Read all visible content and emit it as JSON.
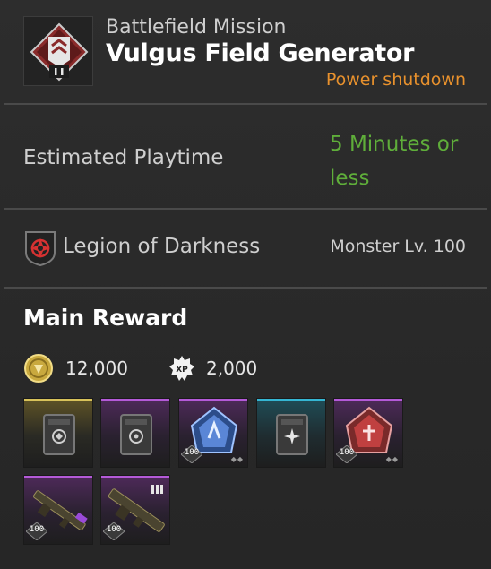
{
  "mission": {
    "category": "Battlefield Mission",
    "title": "Vulgus Field Generator",
    "subtitle": "Power shutdown",
    "icon": "mission-chevron-emblem"
  },
  "playtime": {
    "label": "Estimated Playtime",
    "value": "5 Minutes or less"
  },
  "faction": {
    "name": "Legion of Darkness",
    "monster_level": "Monster Lv. 100",
    "icon": "legion-of-darkness-emblem"
  },
  "rewards": {
    "title": "Main Reward",
    "gold": "12,000",
    "xp": "2,000",
    "xp_badge": "XP",
    "items": [
      {
        "rarity": "gold",
        "icon": "mod-module-icon",
        "level": ""
      },
      {
        "rarity": "purple",
        "icon": "mod-module-icon",
        "level": ""
      },
      {
        "rarity": "purple",
        "icon": "blue-core-crystal-icon",
        "level": "100"
      },
      {
        "rarity": "cyan",
        "icon": "mod-module-icon",
        "level": ""
      },
      {
        "rarity": "purple",
        "icon": "red-core-crystal-icon",
        "level": "100"
      },
      {
        "rarity": "purple",
        "icon": "rifle-weapon-icon",
        "level": "100"
      },
      {
        "rarity": "purple",
        "icon": "machine-gun-weapon-icon",
        "level": "100"
      }
    ]
  },
  "colors": {
    "accent_orange": "#e8912d",
    "playtime_green": "#5fae3a",
    "rarity_gold": "#d8c25a",
    "rarity_purple": "#b45ad8",
    "rarity_cyan": "#35b6d3"
  }
}
